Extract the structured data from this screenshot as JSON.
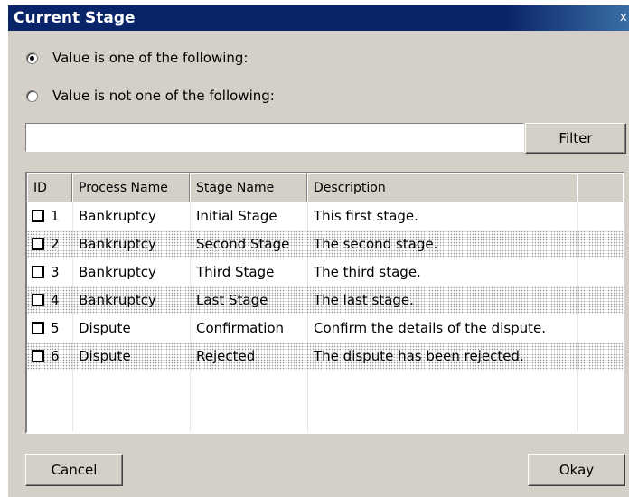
{
  "window": {
    "title": "Current Stage",
    "close_glyph": "x"
  },
  "options": {
    "include_label": "Value is one of the following:",
    "exclude_label": "Value is not one of the following:",
    "selected": "include"
  },
  "filter": {
    "value": "",
    "button_label": "Filter"
  },
  "table": {
    "columns": [
      "ID",
      "Process Name",
      "Stage Name",
      "Description"
    ],
    "rows": [
      {
        "id": "1",
        "process": "Bankruptcy",
        "stage": "Initial Stage",
        "description": "This first stage.",
        "checked": false
      },
      {
        "id": "2",
        "process": "Bankruptcy",
        "stage": "Second Stage",
        "description": "The second stage.",
        "checked": false
      },
      {
        "id": "3",
        "process": "Bankruptcy",
        "stage": "Third Stage",
        "description": "The third stage.",
        "checked": false
      },
      {
        "id": "4",
        "process": "Bankruptcy",
        "stage": "Last Stage",
        "description": "The last stage.",
        "checked": false
      },
      {
        "id": "5",
        "process": "Dispute",
        "stage": "Confirmation",
        "description": "Confirm the details of the dispute.",
        "checked": false
      },
      {
        "id": "6",
        "process": "Dispute",
        "stage": "Rejected",
        "description": "The dispute has been rejected.",
        "checked": false
      }
    ]
  },
  "footer": {
    "cancel_label": "Cancel",
    "okay_label": "Okay"
  },
  "colors": {
    "titlebar": "#0a246a",
    "dialog_face": "#d4d0c8"
  }
}
